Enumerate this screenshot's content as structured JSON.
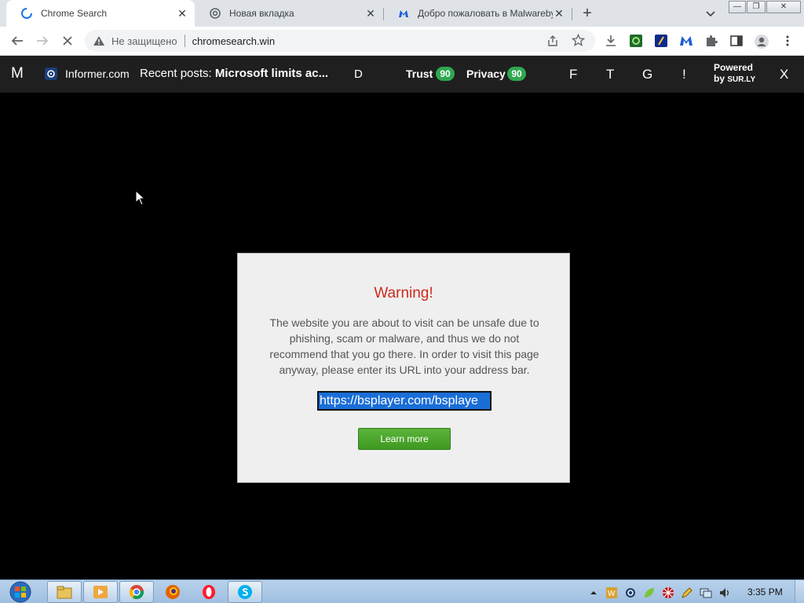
{
  "tabs": [
    {
      "title": "Chrome Search",
      "icon": "loading-spinner-icon",
      "active": true
    },
    {
      "title": "Новая вкладка",
      "icon": "chrome-icon",
      "active": false
    },
    {
      "title": "Добро пожаловать в Malwareby",
      "icon": "malwarebytes-icon",
      "active": false
    }
  ],
  "toolbar": {
    "security_label": "Не защищено",
    "url": "chromesearch.win"
  },
  "surly": {
    "logo": "M",
    "informer": "Informer.com",
    "recent_prefix": "Recent posts:",
    "recent_post": "Microsoft limits ac...",
    "d_letter": "D",
    "trust_label": "Trust",
    "trust_score": "90",
    "privacy_label": "Privacy",
    "privacy_score": "90",
    "f_letter": "F",
    "t_letter": "T",
    "g_letter": "G",
    "excl": "!",
    "powered_line1": "Powered",
    "powered_by": "by",
    "powered_brand": "SUR.LY",
    "close": "X"
  },
  "warning": {
    "title": "Warning!",
    "text": "The website you are about to visit can be unsafe due to phishing, scam or malware, and thus we do not recommend that you go there. In order to visit this page anyway, please enter its URL into your address bar.",
    "url": "https://bsplayer.com/bsplaye",
    "button": "Learn more"
  },
  "taskbar": {
    "clock": "3:35 PM",
    "apps": [
      "explorer-icon",
      "media-player-icon",
      "chrome-icon",
      "firefox-icon",
      "opera-icon",
      "skype-icon"
    ]
  },
  "colors": {
    "warning_title": "#cc2a1f",
    "learn_button": "#4aa52b",
    "badge": "#2fa84f",
    "banner_bg": "#1f1f1f"
  }
}
